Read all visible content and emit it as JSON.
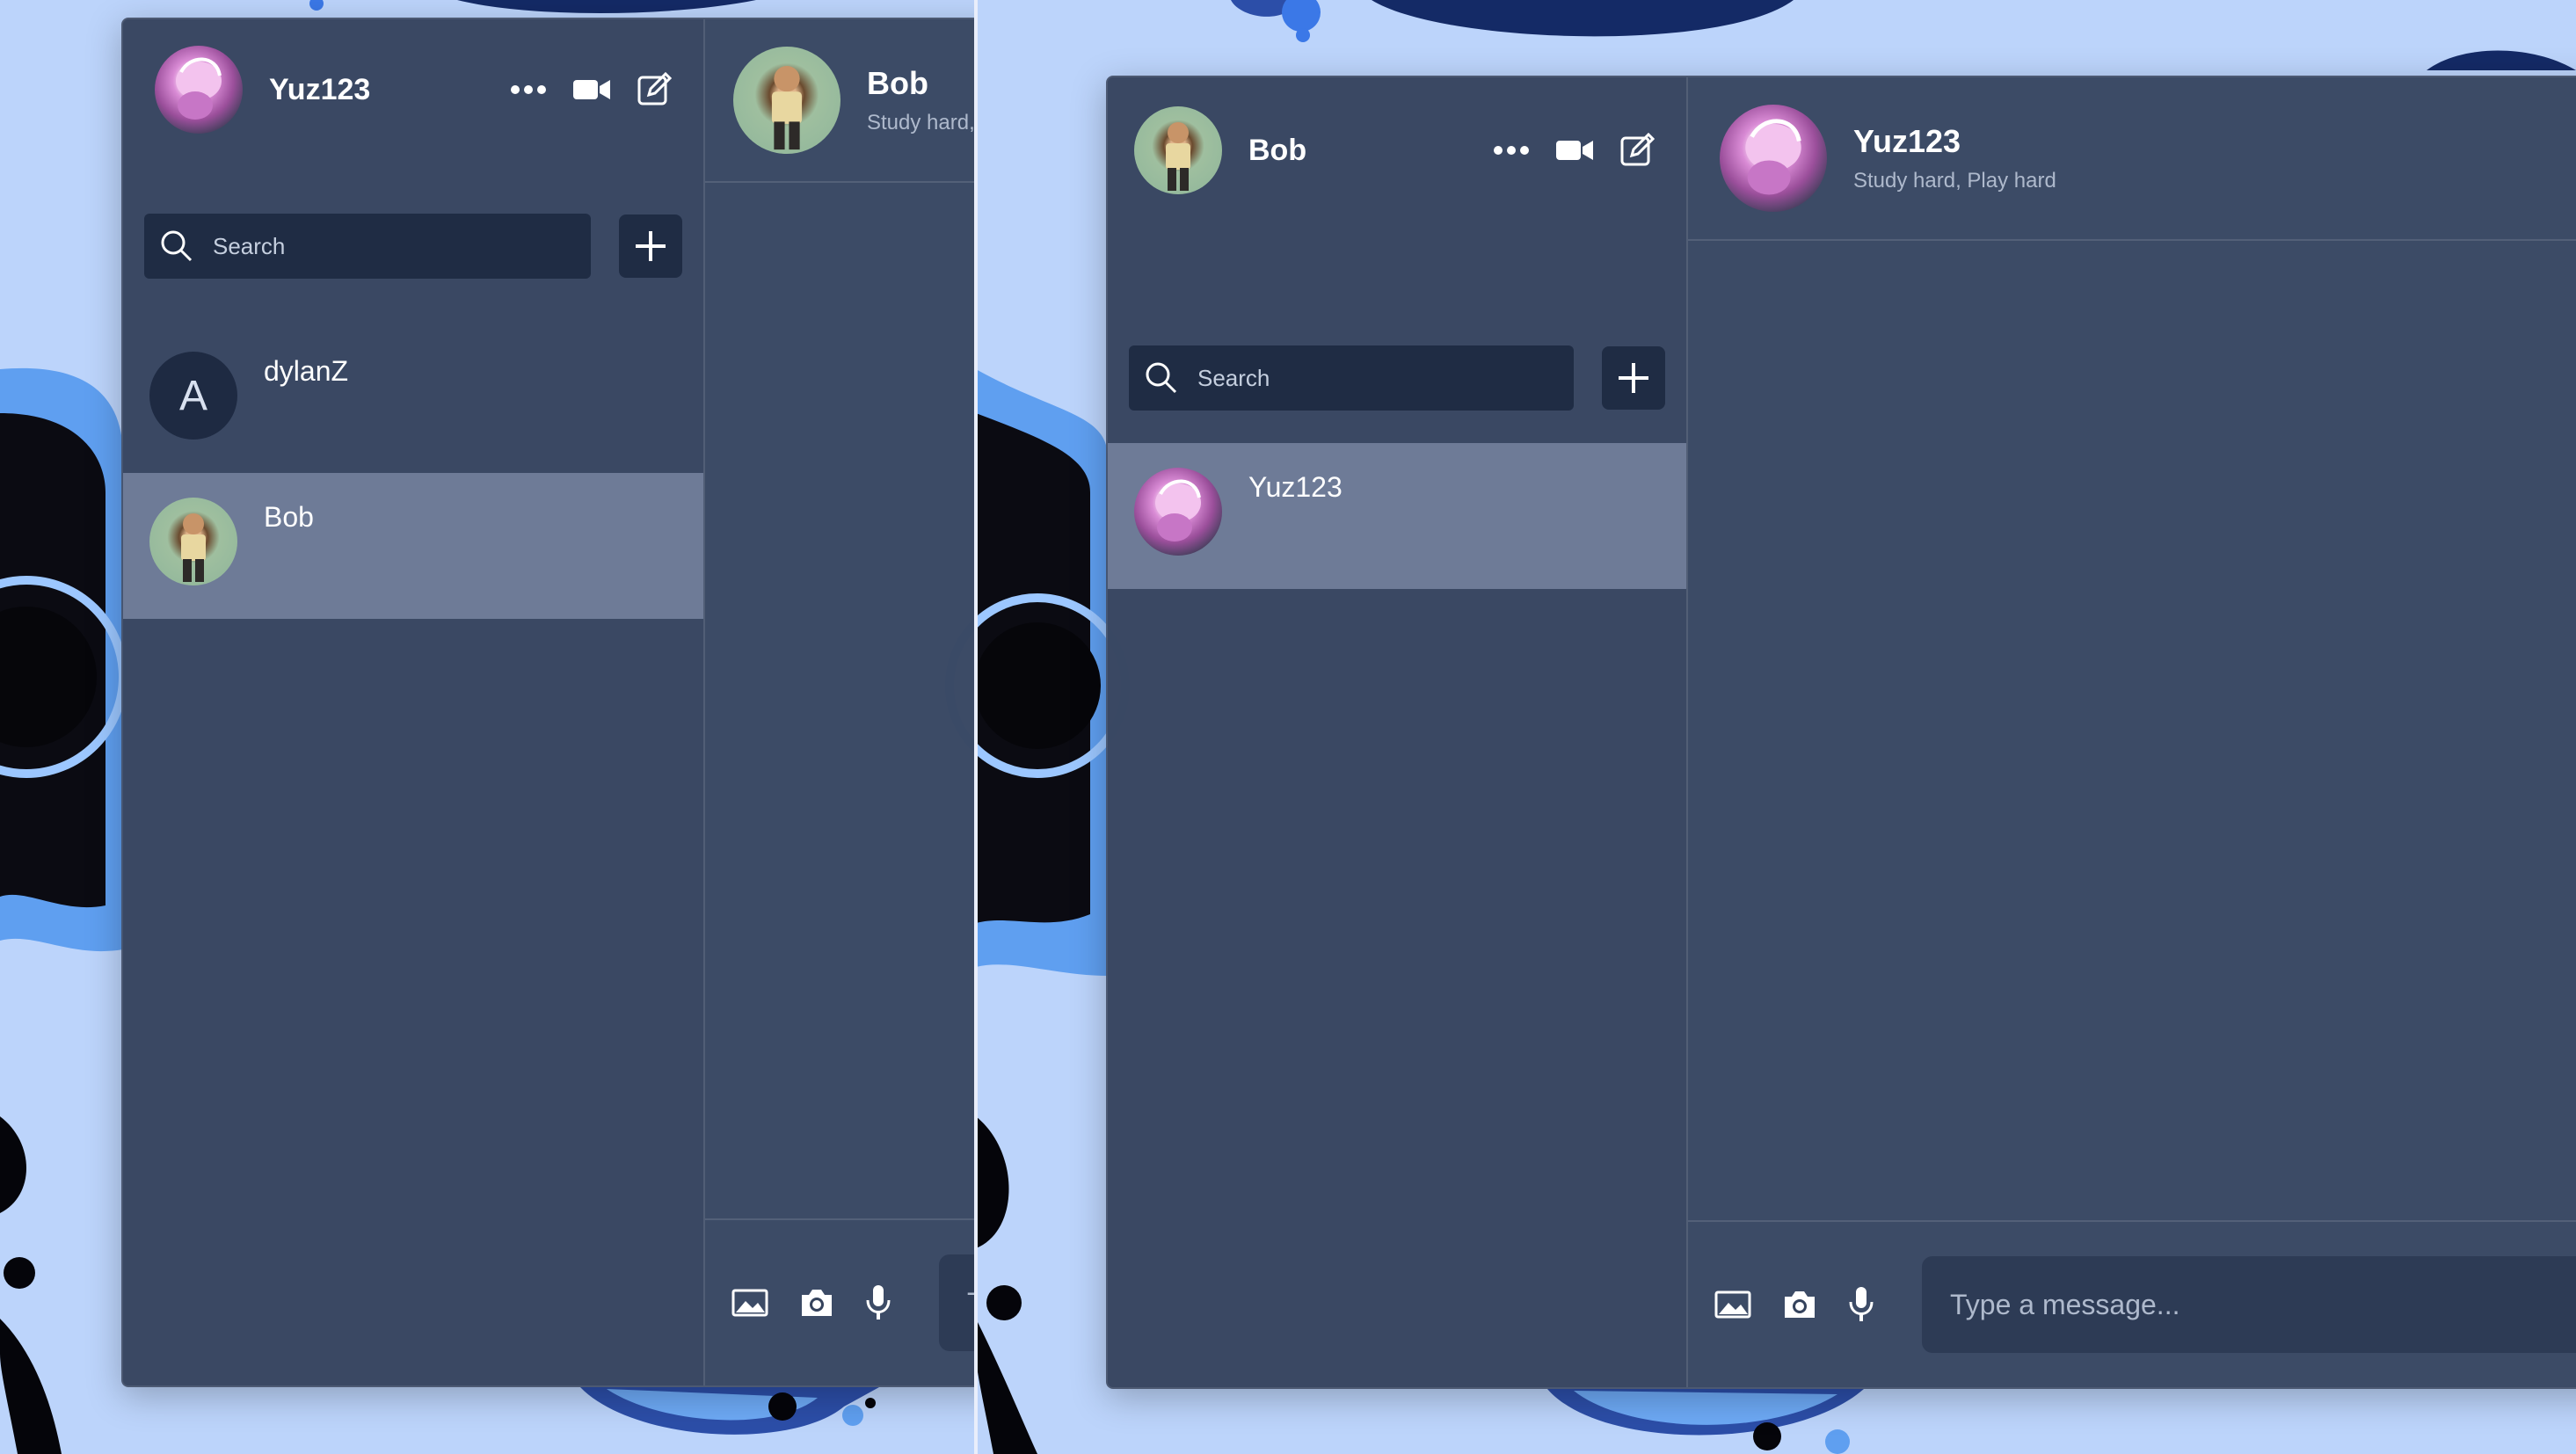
{
  "left_window": {
    "current_user": "Yuz123",
    "search": {
      "placeholder": "Search"
    },
    "conversations": [
      {
        "name": "dylanZ",
        "avatar_letter": "A",
        "active": false
      },
      {
        "name": "Bob",
        "active": true
      }
    ],
    "chat": {
      "title": "Bob",
      "status": "Study hard,"
    },
    "composer": {
      "placeholder": "Ty"
    }
  },
  "right_window": {
    "current_user": "Bob",
    "search": {
      "placeholder": "Search"
    },
    "conversations": [
      {
        "name": "Yuz123",
        "active": true
      }
    ],
    "chat": {
      "title": "Yuz123",
      "status": "Study hard, Play hard"
    },
    "composer": {
      "placeholder": "Type a message..."
    }
  },
  "icons": {
    "more": "more-icon",
    "video": "video-icon",
    "compose": "compose-icon",
    "search": "search-icon",
    "add": "plus-icon",
    "image": "image-icon",
    "camera": "camera-icon",
    "microphone": "microphone-icon"
  },
  "colors": {
    "background": "#bcd4fb",
    "window": "#34425c",
    "active_item": "#78859f",
    "input": "#1f2c44"
  }
}
